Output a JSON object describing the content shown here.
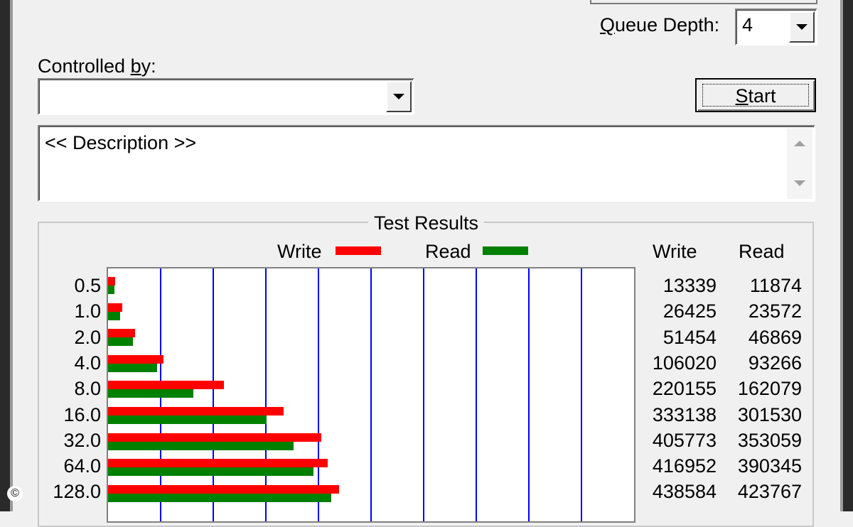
{
  "queue_depth": {
    "label_u": "Q",
    "label_rest": "ueue Depth:",
    "value": "4"
  },
  "controlled_by": {
    "label_pre": "Controlled ",
    "label_u": "b",
    "label_rest": "y:",
    "value": ""
  },
  "start_button": {
    "label_u": "S",
    "label_rest": "tart"
  },
  "description": {
    "text": "<< Description >>"
  },
  "test_results": {
    "title": "Test Results",
    "legend": [
      {
        "name": "Write",
        "color": "#ff0000"
      },
      {
        "name": "Read",
        "color": "#008000"
      }
    ],
    "columns": [
      "Write",
      "Read"
    ],
    "rows": [
      {
        "size": "0.5",
        "write": "13339",
        "read": "11874"
      },
      {
        "size": "1.0",
        "write": "26425",
        "read": "23572"
      },
      {
        "size": "2.0",
        "write": "51454",
        "read": "46869"
      },
      {
        "size": "4.0",
        "write": "106020",
        "read": "93266"
      },
      {
        "size": "8.0",
        "write": "220155",
        "read": "162079"
      },
      {
        "size": "16.0",
        "write": "333138",
        "read": "301530"
      },
      {
        "size": "32.0",
        "write": "405773",
        "read": "353059"
      },
      {
        "size": "64.0",
        "write": "416952",
        "read": "390345"
      },
      {
        "size": "128.0",
        "write": "438584",
        "read": "423767"
      }
    ]
  },
  "chart_data": {
    "type": "bar",
    "orientation": "horizontal",
    "title": "Test Results",
    "categories": [
      "0.5",
      "1.0",
      "2.0",
      "4.0",
      "8.0",
      "16.0",
      "32.0",
      "64.0",
      "128.0"
    ],
    "series": [
      {
        "name": "Write",
        "color": "#ff0000",
        "values": [
          13339,
          26425,
          51454,
          106020,
          220155,
          333138,
          405773,
          416952,
          438584
        ]
      },
      {
        "name": "Read",
        "color": "#008000",
        "values": [
          11874,
          23572,
          46869,
          93266,
          162079,
          301530,
          353059,
          390345,
          423767
        ]
      }
    ],
    "xlim": [
      0,
      1000000
    ],
    "grid": true,
    "gridline_color": "#0000ff"
  },
  "copyright_symbol": "©"
}
